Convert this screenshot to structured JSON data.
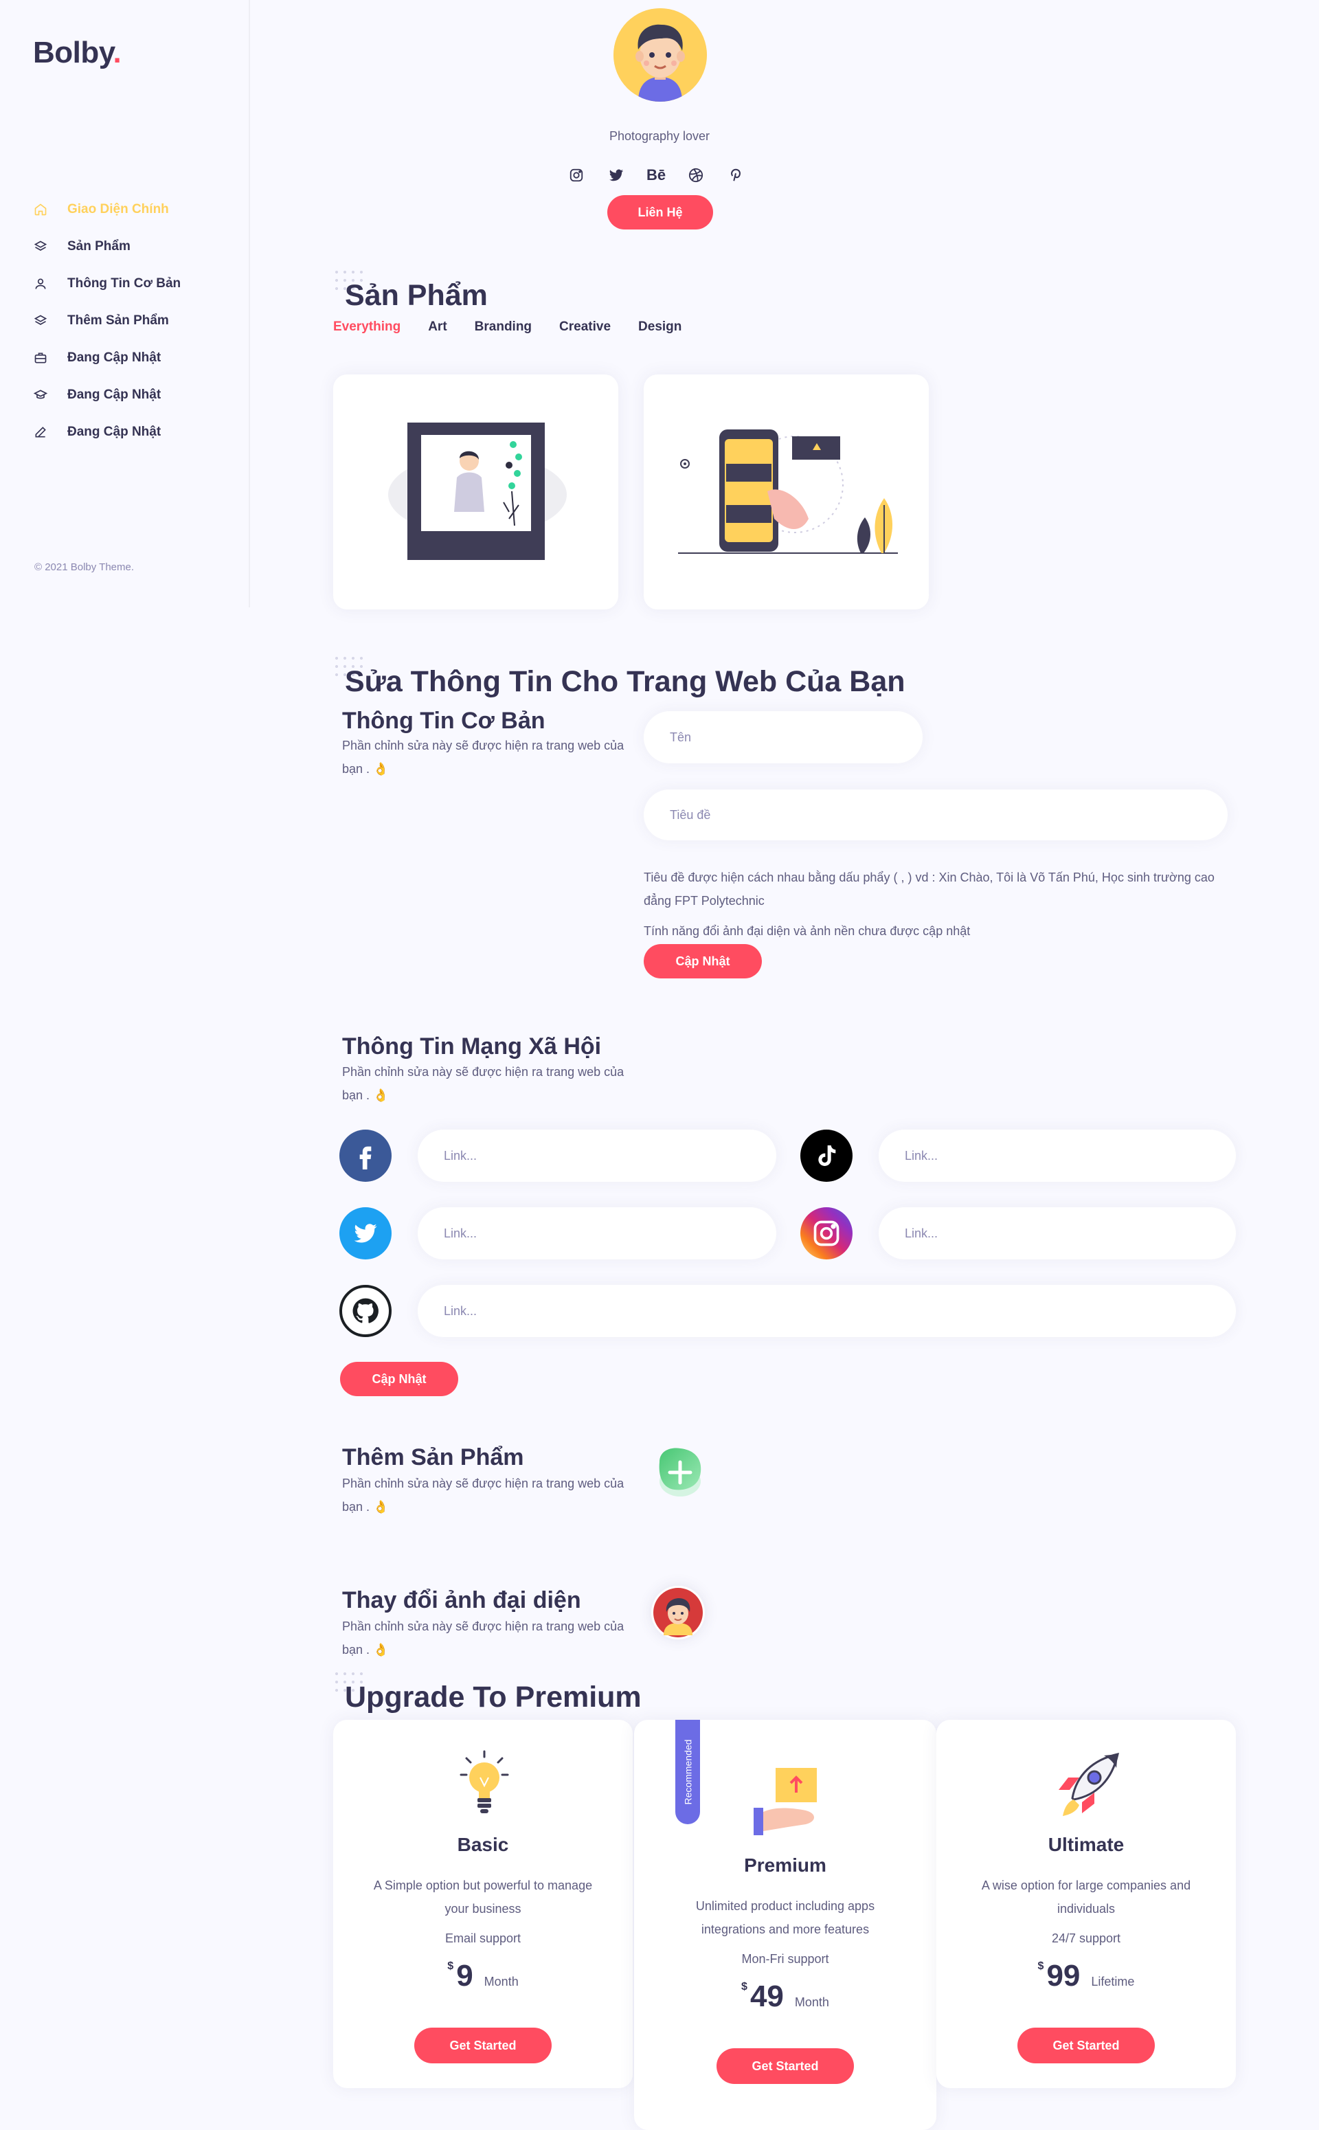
{
  "brand": {
    "name": "Bolby",
    "dot": "."
  },
  "sidebar": {
    "items": [
      {
        "label": "Giao Diện Chính",
        "icon": "home-icon",
        "active": true
      },
      {
        "label": "Sản Phẩm",
        "icon": "layers-icon"
      },
      {
        "label": "Thông Tin Cơ Bản",
        "icon": "user-icon"
      },
      {
        "label": "Thêm Sản Phẩm",
        "icon": "layers-icon"
      },
      {
        "label": "Đang Cập Nhật",
        "icon": "briefcase-icon"
      },
      {
        "label": "Đang Cập Nhật",
        "icon": "graduation-icon"
      },
      {
        "label": "Đang Cập Nhật",
        "icon": "edit-icon"
      }
    ],
    "copyright": "© 2021 Bolby Theme."
  },
  "profile": {
    "tagline": "Photography lover",
    "socials": [
      "instagram-icon",
      "twitter-icon",
      "behance-icon",
      "dribbble-icon",
      "pinterest-icon"
    ],
    "behance_text": "Bē",
    "contact_label": "Liên Hệ"
  },
  "products": {
    "title": "Sản Phẩm",
    "filters": [
      "Everything",
      "Art",
      "Branding",
      "Creative",
      "Design"
    ]
  },
  "edit": {
    "title": "Sửa Thông Tin Cho Trang Web Của Bạn",
    "basic": {
      "title": "Thông Tin Cơ Bản",
      "desc": "Phần chỉnh sửa này sẽ được hiện ra trang web của bạn . 👌",
      "name_placeholder": "Tên",
      "headline_placeholder": "Tiêu đề",
      "note1": "Tiêu đề được hiện cách nhau bằng dấu phẩy ( , ) vd : Xin Chào, Tôi là Võ Tấn Phú, Học sinh trường cao đẳng FPT Polytechnic",
      "note2": "Tính năng đổi ảnh đại diện và ảnh nền chưa được cập nhật",
      "update_label": "Cập Nhật"
    },
    "social": {
      "title": "Thông Tin Mạng Xã Hội",
      "desc": "Phần chỉnh sửa này sẽ được hiện ra trang web của bạn . 👌",
      "link_placeholder": "Link...",
      "update_label": "Cập Nhật"
    },
    "add_product": {
      "title": "Thêm Sản Phẩm",
      "desc": "Phần chỉnh sửa này sẽ được hiện ra trang web của bạn . 👌"
    },
    "avatar": {
      "title": "Thay đổi ảnh đại diện",
      "desc": "Phần chỉnh sửa này sẽ được hiện ra trang web của bạn . 👌"
    }
  },
  "pricing": {
    "title": "Upgrade To Premium",
    "plans": [
      {
        "name": "Basic",
        "desc": "A Simple option but powerful to manage your business",
        "support": "Email support",
        "currency": "$",
        "price": "9",
        "period": "Month",
        "cta": "Get Started"
      },
      {
        "name": "Premium",
        "desc": "Unlimited product including apps integrations and more features",
        "support": "Mon-Fri support",
        "currency": "$",
        "price": "49",
        "period": "Month",
        "cta": "Get Started",
        "ribbon": "Recommended"
      },
      {
        "name": "Ultimate",
        "desc": "A wise option for large companies and individuals",
        "support": "24/7 support",
        "currency": "$",
        "price": "99",
        "period": "Lifetime",
        "cta": "Get Started"
      }
    ]
  },
  "colors": {
    "accent": "#ff4c60",
    "yellow": "#ffd15c",
    "dark": "#353353",
    "purple": "#6c6ce5",
    "bg": "#f9f9ff"
  }
}
